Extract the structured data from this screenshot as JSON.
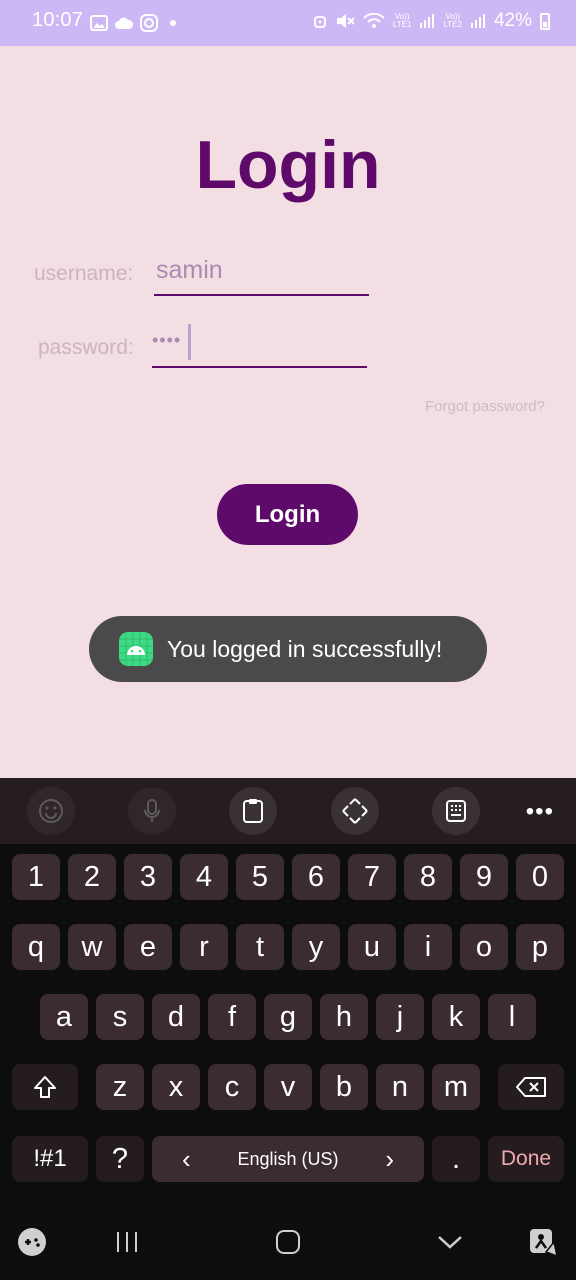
{
  "status": {
    "time": "10:07",
    "battery_pct": "42%",
    "sim1": "Vo))\nLTE1",
    "sim2": "Vo))\nLTE2",
    "icons_left": [
      "gallery-icon",
      "cloud-icon",
      "instagram-icon",
      "dot-icon"
    ],
    "icons_right": [
      "alarm-icon",
      "mute-icon",
      "wifi-icon",
      "signal-icon",
      "battery-icon"
    ]
  },
  "login": {
    "title": "Login",
    "username_label": "username:",
    "username_value": "samin",
    "password_label": "password:",
    "password_value": "••••",
    "forgot": "Forgot password?",
    "button": "Login"
  },
  "toast": {
    "text": "You logged in successfully!"
  },
  "keyboard": {
    "toolbar": [
      "emoji-icon",
      "mic-icon",
      "clipboard-icon",
      "cursor-move-icon",
      "keypad-icon",
      "more-icon"
    ],
    "more_label": "•••",
    "row_numbers": [
      "1",
      "2",
      "3",
      "4",
      "5",
      "6",
      "7",
      "8",
      "9",
      "0"
    ],
    "row_q": [
      "q",
      "w",
      "e",
      "r",
      "t",
      "y",
      "u",
      "i",
      "o",
      "p"
    ],
    "row_a": [
      "a",
      "s",
      "d",
      "f",
      "g",
      "h",
      "j",
      "k",
      "l"
    ],
    "row_z": [
      "z",
      "x",
      "c",
      "v",
      "b",
      "n",
      "m"
    ],
    "sym_key": "!#1",
    "question_key": "?",
    "space_label": "English (US)",
    "period_key": ".",
    "done_key": "Done",
    "left_arrow": "‹",
    "right_arrow": "›"
  },
  "nav": [
    "gamepad-icon",
    "recents-icon",
    "home-icon",
    "hide-keyboard-icon",
    "accessibility-icon"
  ],
  "colors": {
    "accent": "#5e0a6b",
    "background": "#f3dfe3",
    "statusbar": "#cdb8f6",
    "toast": "#4a4a4a",
    "keyboard": "#0d0d0d"
  }
}
